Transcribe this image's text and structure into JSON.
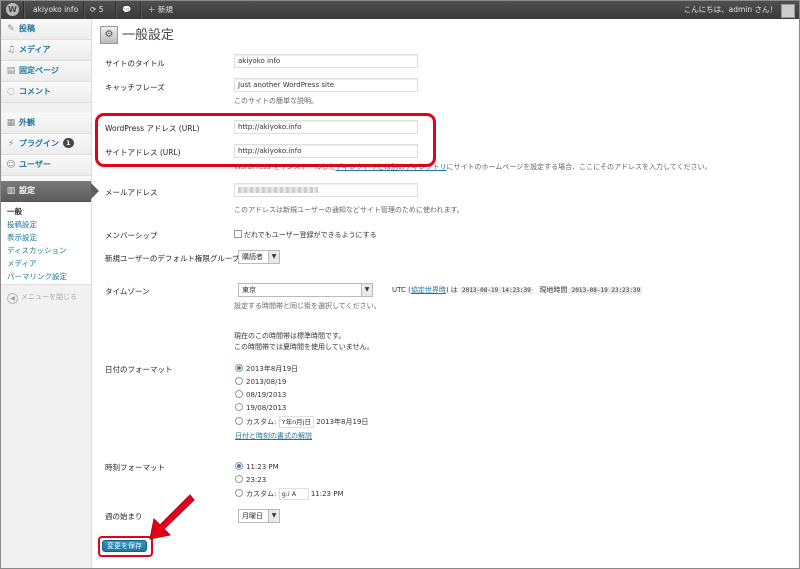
{
  "adminbar": {
    "site_name": "akiyoko info",
    "updates_count": "5",
    "new_label": "＋ 新規",
    "greeting": "こんにちは、admin さん！"
  },
  "sidebar": {
    "items": [
      {
        "label": "投稿",
        "icon": "pin-icon"
      },
      {
        "label": "メディア",
        "icon": "media-icon"
      },
      {
        "label": "固定ページ",
        "icon": "page-icon"
      },
      {
        "label": "コメント",
        "icon": "comment-icon"
      },
      {
        "label": "外観",
        "icon": "appearance-icon"
      },
      {
        "label": "プラグイン",
        "icon": "plugin-icon",
        "badge": "1"
      },
      {
        "label": "ユーザー",
        "icon": "users-icon"
      },
      {
        "label": "ツール",
        "icon": "tools-icon"
      },
      {
        "label": "設定",
        "icon": "settings-icon"
      }
    ],
    "submenu": [
      "一般",
      "投稿設定",
      "表示設定",
      "ディスカッション",
      "メディア",
      "パーマリンク設定"
    ],
    "collapse_label": "メニューを閉じる"
  },
  "page": {
    "title": "一般設定",
    "site_title_label": "サイトのタイトル",
    "site_title_value": "akiyoko info",
    "tagline_label": "キャッチフレーズ",
    "tagline_value": "Just another WordPress site",
    "tagline_desc": "このサイトの簡単な説明。",
    "wp_address_label": "WordPress アドレス (URL)",
    "wp_address_value": "http://akiyoko.info",
    "site_address_label": "サイトアドレス (URL)",
    "site_address_value": "http://akiyoko.info",
    "site_address_desc_pre": "WordPress をインストールした",
    "site_address_desc_link": "ディレクトリとは別のディレクトリ",
    "site_address_desc_post": "にサイトのホームページを設定する場合、ここにそのアドレスを入力してください。",
    "email_label": "メールアドレス",
    "email_desc": "このアドレスは新規ユーザーの通知などサイト管理のために使われます。",
    "membership_label": "メンバーシップ",
    "membership_checkbox": "だれでもユーザー登録ができるようにする",
    "default_role_label": "新規ユーザーのデフォルト権限グループ",
    "default_role_value": "購読者",
    "timezone_label": "タイムゾーン",
    "timezone_value": "東京",
    "utc_prefix": "UTC (",
    "utc_link": "協定世界時",
    "utc_suffix": ") は",
    "utc_time": "2013-08-19 14:23:39",
    "local_label": "現地時間",
    "local_time": "2013-08-19 23:23:39",
    "timezone_desc": "設定する時間帯と同じ街を選択してください。",
    "std_time_note": "現在のこの時間帯は標準時間です。",
    "dst_note": "この時間帯では夏時間を使用していません。",
    "date_format_label": "日付のフォーマット",
    "date_formats": [
      "2013年8月19日",
      "2013/08/19",
      "08/19/2013",
      "19/08/2013"
    ],
    "custom_label": "カスタム:",
    "date_custom_input": "Y年n月j日",
    "date_custom_preview": "2013年8月19日",
    "date_doc_link": "日付と時刻の書式の解説",
    "time_format_label": "時刻フォーマット",
    "time_formats": [
      "11:23 PM",
      "23:23"
    ],
    "time_custom_input": "g:i A",
    "time_custom_preview": "11:23 PM",
    "week_start_label": "週の始まり",
    "week_start_value": "月曜日",
    "save_label": "変更を保存"
  },
  "colors": {
    "highlight": "#e2001a",
    "link": "#21759b",
    "admin_bar": "#464646"
  }
}
